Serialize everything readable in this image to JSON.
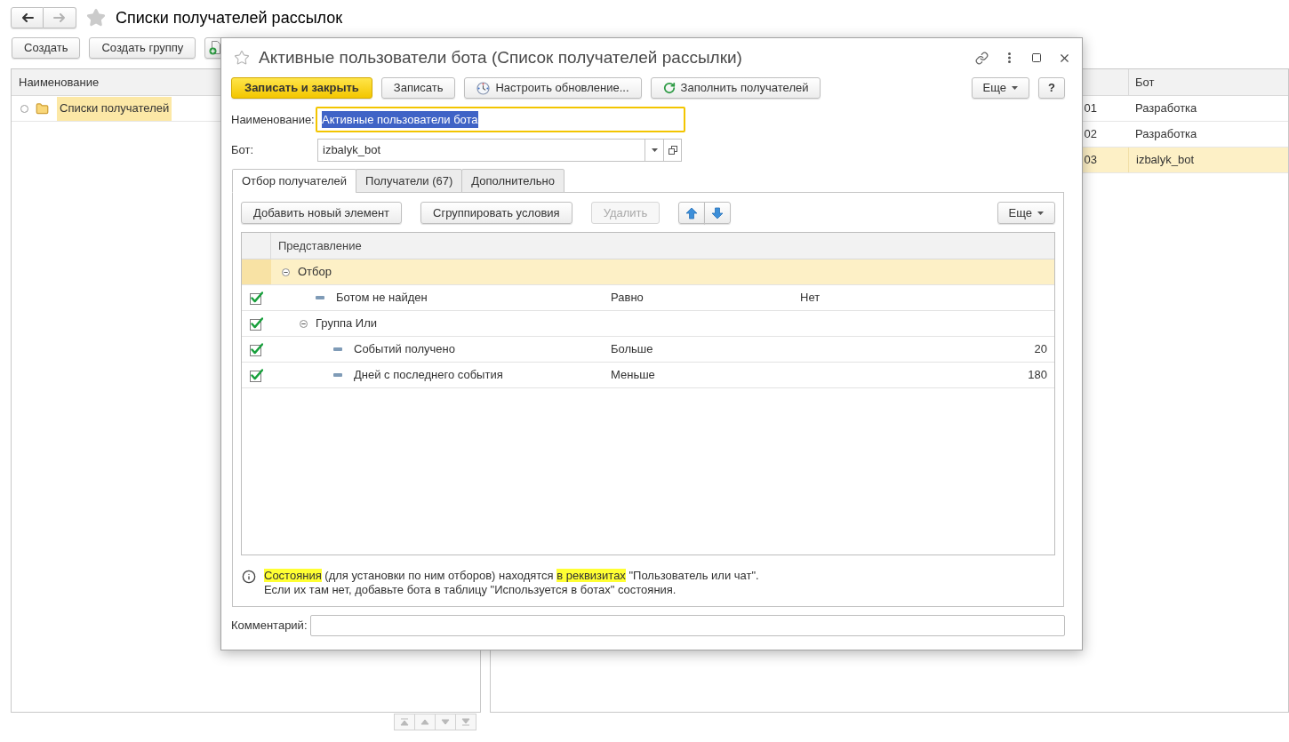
{
  "page": {
    "nav": {
      "back": {
        "disabled": false
      },
      "forward": {
        "disabled": true
      }
    },
    "title": "Списки получателей рассылок",
    "toolbar": [
      {
        "label": "Создать"
      },
      {
        "label": "Создать группу"
      }
    ],
    "groups_list": {
      "columns": [
        "Наименование"
      ],
      "items": [
        {
          "label": "Списки получателей",
          "selected": true
        }
      ]
    },
    "items_list": {
      "columns": [
        "Бот"
      ],
      "rows": [
        {
          "column_1": "01",
          "bot": "Разработка",
          "selected": false
        },
        {
          "column_1": "02",
          "bot": "Разработка",
          "selected": false
        },
        {
          "column_1": "03",
          "bot": "izbalyk_bot",
          "selected": true
        }
      ]
    }
  },
  "dialog": {
    "title": "Активные пользователи бота (Список получателей рассылки)",
    "toolbar": [
      {
        "label": "Записать и закрыть",
        "kind": "primary"
      },
      {
        "label": "Записать",
        "kind": "plain"
      },
      {
        "label": "Настроить обновление...",
        "kind": "plain"
      },
      {
        "label": "Заполнить получателей",
        "kind": "plain"
      }
    ],
    "more_button": "Еще",
    "help_button": "?",
    "fields": {
      "name": {
        "label": "Наименование:",
        "value": "Активные пользователи бота",
        "focused": true,
        "text_selected": true
      },
      "bot": {
        "label": "Бот:",
        "value": "izbalyk_bot"
      }
    },
    "tabs": [
      {
        "label": "Отбор получателей",
        "selected": true
      },
      {
        "label": "Получатели (67)",
        "selected": false
      },
      {
        "label": "Дополнительно",
        "selected": false
      }
    ],
    "filter": {
      "toolbar": [
        {
          "label": "Добавить новый элемент",
          "disabled": false
        },
        {
          "label": "Сгруппировать условия",
          "disabled": false
        },
        {
          "label": "Удалить",
          "disabled": true
        }
      ],
      "more_button": "Еще",
      "table": {
        "columns": [
          "Представление"
        ],
        "rows": [
          {
            "kind": "group",
            "label": "Отбор",
            "selected": true,
            "expanded": true,
            "children": [
              {
                "kind": "condition",
                "label": "Ботом не найден",
                "checked": true,
                "selected": false,
                "comparison": "Равно",
                "value": "Нет",
                "numeric": false
              },
              {
                "kind": "group",
                "label": "Группа Или",
                "checked": true,
                "selected": false,
                "expanded": true,
                "children": [
                  {
                    "kind": "condition",
                    "label": "Событий получено",
                    "checked": true,
                    "selected": false,
                    "comparison": "Больше",
                    "value": "20",
                    "numeric": true
                  },
                  {
                    "kind": "condition",
                    "label": "Дней с последнего события",
                    "checked": true,
                    "selected": false,
                    "comparison": "Меньше",
                    "value": "180",
                    "numeric": true
                  }
                ]
              }
            ]
          }
        ]
      }
    },
    "info": {
      "lines": [
        [
          {
            "text": "Состояния",
            "highlighted": true
          },
          {
            "text": " (для установки по ним отборов) находятся ",
            "highlighted": false
          },
          {
            "text": "в реквизитах",
            "highlighted": true
          },
          {
            "text": " \"Пользователь или чат\".",
            "highlighted": false
          }
        ],
        [
          {
            "text": "Если их там нет, добавьте бота в таблицу \"Используется в ботах\" состояния.",
            "highlighted": false
          }
        ]
      ]
    },
    "comment": {
      "label": "Комментарий:"
    }
  }
}
